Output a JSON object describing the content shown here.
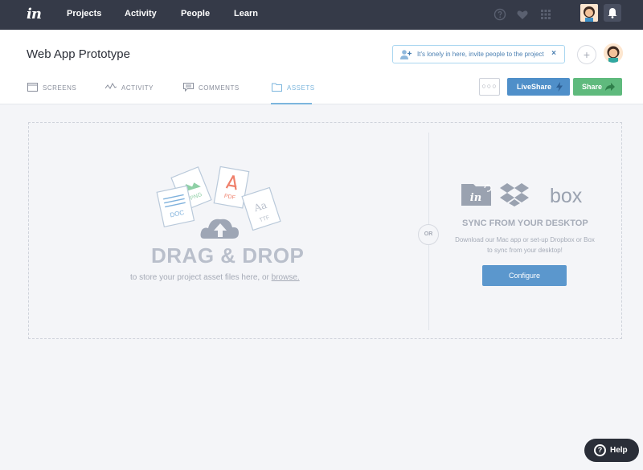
{
  "nav": {
    "logo": "in",
    "links": [
      "Projects",
      "Activity",
      "People",
      "Learn"
    ]
  },
  "header": {
    "project_title": "Web App Prototype",
    "invite_text": "It's lonely in here, invite people to the project",
    "invite_close": "×",
    "plus": "+",
    "tabs": [
      "SCREENS",
      "ACTIVITY",
      "COMMENTS",
      "ASSETS"
    ],
    "active_tab": "ASSETS",
    "more_label": "○○○",
    "liveshare_label": "LiveShare",
    "share_label": "Share"
  },
  "upload": {
    "file_types": [
      "DOC",
      "PNG",
      "PDF",
      "TTF"
    ],
    "file_glyph": "Aa",
    "title": "DRAG & DROP",
    "subtitle_prefix": "to store your project asset files here, or ",
    "browse_label": "browse."
  },
  "or_label": "OR",
  "sync": {
    "in_logo": "in",
    "box_logo": "box",
    "title": "SYNC FROM YOUR DESKTOP",
    "description": "Download our Mac app or set-up Dropbox or Box to sync from your desktop!",
    "configure_label": "Configure"
  },
  "help": {
    "q": "?",
    "label": "Help"
  },
  "colors": {
    "nav_bg": "#353a48",
    "liveshare": "#4f8fc9",
    "share": "#5fba7d",
    "configure": "#5b97cd",
    "tab_active_underline": "#7cb6dd"
  }
}
